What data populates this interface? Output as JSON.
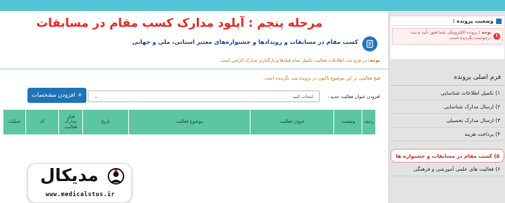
{
  "page": {
    "title": "مرحله پنجم : آپلود مدارک کسب مقام در مسابقات",
    "subtitle": "کسب مقام در مسابقات و رویدادها و جشنواره‌های معتبر استانی، ملی و جهانی",
    "note_label": "توجه:",
    "note_text": " در فرم ثبت اطلاعات فعالیت تکمیل تمام فیلدها و بارگذاری مدارک الزامی است.",
    "no_items": "هیچ فعالیتی در این موضوع تاکنون در پرونده ثبت نگردیده است.",
    "add_label": "افزودن عنوان فعالیت جدید :",
    "select_value": "انتخاب کنید",
    "add_button": "افزودن مشخصات",
    "add_icon": "+"
  },
  "table": {
    "headers": [
      "ردیف",
      "وضعیت",
      "عنوان فعالیت",
      "موضوع فعالیت",
      "تاریخ",
      "فایل مدارک فعالیت",
      "کد",
      "عملیات"
    ]
  },
  "sidebar": {
    "status_title": "وضعیت پرونده :",
    "status_label": "توجه :",
    "status_text": " پرونده الکترونیکی شما هنوز تأیید و ثبت درخواست نگردیده است.",
    "alert_icon": "!",
    "menu_title": "فرم اصلی پرونده",
    "items": [
      "۱) تکمیل اطلاعات شناسایی",
      "۲) ارسال مدارک شناسایی",
      "۳) ارسال مدارک تحصیلی",
      "۴) پرداخت هزینه",
      "۵) کسب مقام در مسابقات و جشنواره ها",
      "۶) فعالیت های علمی آموزشی و فرهنگی"
    ]
  },
  "logo": {
    "wordmark": "مدیکال",
    "url": "www.medicalstus.ir"
  },
  "colors": {
    "topbar": "#53c4d6",
    "title_red": "#e8231f",
    "primary_blue": "#1f74b8",
    "table_green": "#5cc6a0",
    "note_orange": "#c26f00",
    "sidebar_bg": "#e3e3e3"
  }
}
